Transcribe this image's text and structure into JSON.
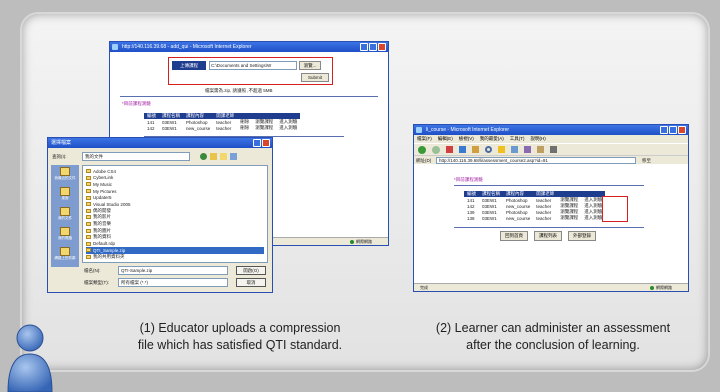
{
  "captions": {
    "left": [
      "(1) Educator uploads a compression",
      "file which has satisfied QTI standard."
    ],
    "right": [
      "(2) Learner can administer an assessment",
      "after the conclusion of learning."
    ]
  },
  "window1": {
    "title": "http://140.116.39.68 - add_qui - Microsoft Internet Explorer",
    "upload_button": "上傳課程",
    "path_value": "C:\\Documents and Settings\\W",
    "browse_button": "瀏覽...",
    "submit_button": "Submit",
    "note": "檔案需為.zip, 請遵照 ,不超過 5MB",
    "section_title": "*目前課程測驗",
    "table": {
      "headers": [
        "編號",
        "課程名稱",
        "課程內容",
        "開課老師",
        "",
        "",
        ""
      ],
      "rows": [
        [
          "141",
          "03EW1",
          "Photoshop",
          "teacher",
          "刪除",
          "瀏覽課程",
          "進入測驗"
        ],
        [
          "142",
          "03EW1",
          "new_course",
          "teacher",
          "刪除",
          "瀏覽課程",
          "進入測驗"
        ]
      ]
    }
  },
  "window2": {
    "title": "選擇檔案",
    "lookin_label": "查詢(I):",
    "lookin_value": "我的文件",
    "places": [
      "我最近的文件",
      "桌面",
      "我的文件",
      "我的電腦",
      "網路上的芳鄰"
    ],
    "files": [
      "Adobe CS4",
      "CyberLink",
      "My Music",
      "My Pictures",
      "Updater5",
      "Visual Studio 2005",
      "偶的開發",
      "我的影片",
      "我的音樂",
      "我的圖片",
      "我的資料",
      "Default.rdp",
      "QTI_Sample.zip",
      "我的共用資料夾"
    ],
    "filename_label": "檔名(N):",
    "filename_value": "QTI-Sample.zip",
    "filetype_label": "檔案類型(T):",
    "filetype_value": "所有檔案 (*.*)",
    "open_button": "開啟(O)",
    "cancel_button": "取消"
  },
  "window3": {
    "title": "li_course - Microsoft Internet Explorer",
    "menu": [
      "檔案(F)",
      "編輯(E)",
      "檢視(V)",
      "我的最愛(A)",
      "工具(T)",
      "說明(H)"
    ],
    "address_label": "網址(D)",
    "address_value": "http://140.116.39.68/li/assessment_course2.asp?id=91",
    "go_button": "移至",
    "section_title": "*目前課程測驗",
    "table": {
      "headers": [
        "編號",
        "課程名稱",
        "課程內容",
        "開課老師",
        "",
        ""
      ],
      "rows": [
        [
          "141",
          "03EW1",
          "Photoshop",
          "teacher",
          "瀏覽課程",
          "進入測驗"
        ],
        [
          "142",
          "03EW1",
          "new_course",
          "teacher",
          "瀏覽課程",
          "進入測驗"
        ],
        [
          "139",
          "03EW1",
          "Photoshop",
          "teacher",
          "瀏覽課程",
          "進入測驗"
        ],
        [
          "138",
          "03EW1",
          "new_course",
          "teacher",
          "瀏覽課程",
          "進入測驗"
        ]
      ]
    },
    "bottom_buttons": [
      "回到首頁",
      "課程列表",
      "外部登錄"
    ],
    "status_left": "完成",
    "status_zone": "網際網路"
  },
  "window1_status_zone": "網際網路"
}
